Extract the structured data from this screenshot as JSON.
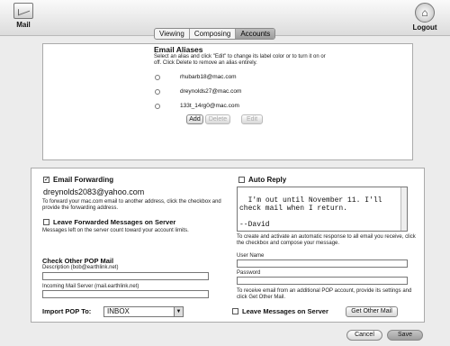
{
  "app": {
    "mail_label": "Mail",
    "logout_label": "Logout"
  },
  "tabs": [
    {
      "label": "Viewing",
      "active": false
    },
    {
      "label": "Composing",
      "active": false
    },
    {
      "label": "Accounts",
      "active": true
    }
  ],
  "aliases": {
    "title": "Email Aliases",
    "help": "Select an alias and click \"Edit\" to change its label color or to turn it on or off. Click Delete to remove an alias entirely.",
    "items": [
      "rhubarb18@mac.com",
      "dreynolds27@mac.com",
      "133t_14rg0@mac.com"
    ],
    "buttons": {
      "add": "Add",
      "delete": "Delete",
      "edit": "Edit"
    }
  },
  "forwarding": {
    "title": "Email Forwarding",
    "checked": true,
    "address": "dreynolds2083@yahoo.com",
    "help": "To forward your mac.com email to another address, click the checkbox and provide the forwarding address.",
    "leave_label": "Leave Forwarded Messages on Server",
    "leave_help": "Messages left on the server count toward your account limits."
  },
  "auto_reply": {
    "title": "Auto Reply",
    "checked": false,
    "message": "I'm out until November 11. I'll check mail when I return.\n\n--David",
    "help": "To create and activate an automatic response to all email you receive, click the checkbox and compose your message."
  },
  "pop": {
    "title": "Check Other POP Mail",
    "description_label": "Description (bob@earthlink.net)",
    "server_label": "Incoming Mail Server (mail.earthlink.net)",
    "username_label": "User Name",
    "password_label": "Password",
    "help": "To receive email from an additional POP account, provide its settings and click Get Other Mail.",
    "import_label": "Import POP To:",
    "import_value": "INBOX",
    "leave_label": "Leave Messages on Server",
    "get_button": "Get Other Mail"
  },
  "footer": {
    "cancel": "Cancel",
    "save": "Save"
  }
}
